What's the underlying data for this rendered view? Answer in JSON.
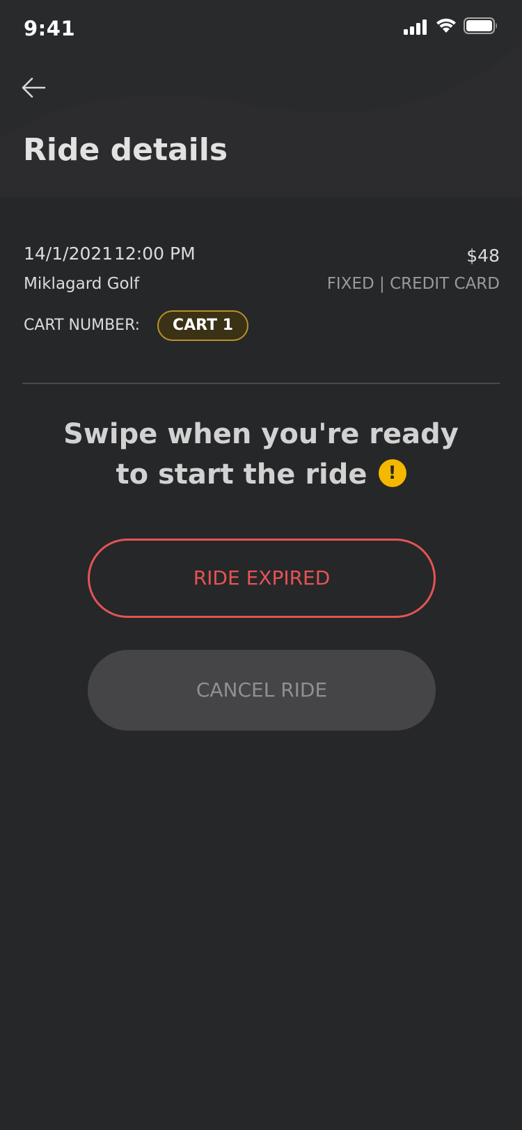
{
  "status_bar": {
    "time": "9:41"
  },
  "header": {
    "back_icon": "arrow-left-icon",
    "title": "Ride details"
  },
  "ride": {
    "date": "14/1/2021",
    "time": "12:00 PM",
    "price": "$48",
    "location": "Miklagard Golf",
    "payment": "FIXED | CREDIT CARD",
    "cart_label": "CART NUMBER:",
    "cart_value": "CART 1"
  },
  "swipe": {
    "line1": "Swipe when you're ready",
    "line2": "to start the ride",
    "warning_icon_text": "!"
  },
  "buttons": {
    "ride_expired": "RIDE EXPIRED",
    "cancel_ride": "CANCEL RIDE"
  },
  "colors": {
    "background": "#262729",
    "header": "#2c2c2e",
    "expired": "#e65454",
    "badge_border": "#b8922c",
    "warning": "#f5b800"
  }
}
